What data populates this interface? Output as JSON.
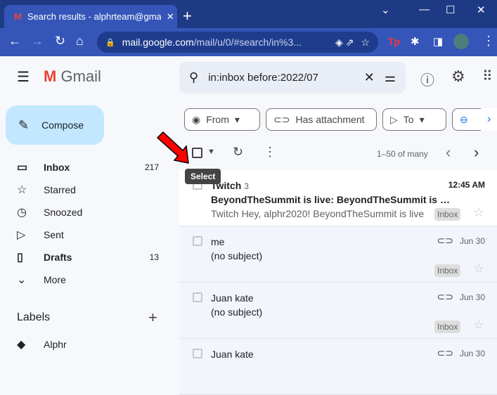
{
  "browser": {
    "tab_title": "Search results - alphrteam@gmail.com",
    "url_host": "mail.google.com",
    "url_path": "/mail/u/0/#search/in%3..."
  },
  "gmail": {
    "logo": "Gmail",
    "search_value": "in:inbox before:2022/07",
    "filters": [
      "From",
      "Has attachment",
      "To"
    ],
    "compose": "Compose",
    "nav": [
      {
        "label": "Inbox",
        "count": "217",
        "bold": true,
        "icon": "inbox-icon"
      },
      {
        "label": "Starred",
        "count": "",
        "icon": "star-icon"
      },
      {
        "label": "Snoozed",
        "count": "",
        "icon": "clock-icon"
      },
      {
        "label": "Sent",
        "count": "",
        "icon": "send-icon"
      },
      {
        "label": "Drafts",
        "count": "13",
        "bold": true,
        "icon": "file-icon"
      },
      {
        "label": "More",
        "count": "",
        "icon": "chevron-down-icon"
      }
    ],
    "labels_heading": "Labels",
    "labels": [
      "Alphr"
    ],
    "pagination": "1–50 of many",
    "tooltip": "Select",
    "emails": [
      {
        "from": "Twitch",
        "count": "3",
        "subject": "BeyondTheSummit is live: BeyondTheSummit is LIVE",
        "snippet": "Twitch Hey, alphr2020! BeyondTheSummit is live",
        "date": "12:45 AM",
        "badge": "Inbox",
        "unread": true
      },
      {
        "from": "me",
        "subject": "(no subject)",
        "date": "Jun 30",
        "badge": "Inbox",
        "attachment": true
      },
      {
        "from": "Juan kate",
        "subject": "(no subject)",
        "date": "Jun 30",
        "badge": "Inbox",
        "attachment": true
      },
      {
        "from": "Juan kate",
        "subject": "",
        "date": "Jun 30",
        "badge": "",
        "attachment": true
      }
    ]
  },
  "colors": {
    "accent": "#c2e7ff",
    "annotation_arrow": "#ff0000"
  }
}
